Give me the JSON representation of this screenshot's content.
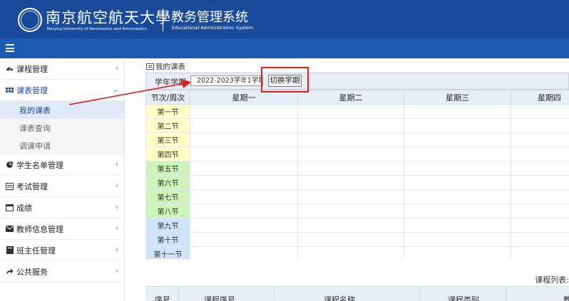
{
  "header": {
    "university_cn": "南京航空航天大學",
    "university_en": "Nanjing University of Aeronautics and Astronautics",
    "system_cn": "教务管理系统",
    "system_en": "Educational Administration System"
  },
  "sidebar": {
    "items": [
      {
        "label": "课程管理",
        "icon": "dashboard-icon"
      },
      {
        "label": "课表管理",
        "icon": "grid-icon",
        "open": true,
        "children": [
          {
            "label": "我的课表",
            "active": true
          },
          {
            "label": "课表查询"
          },
          {
            "label": "调课申请"
          }
        ]
      },
      {
        "label": "学生名单管理",
        "icon": "pie-chart-icon"
      },
      {
        "label": "考试管理",
        "icon": "list-icon"
      },
      {
        "label": "成绩",
        "icon": "calendar-icon"
      },
      {
        "label": "教师信息管理",
        "icon": "envelope-icon"
      },
      {
        "label": "班主任管理",
        "icon": "book-icon"
      },
      {
        "label": "公共服务",
        "icon": "share-icon"
      }
    ]
  },
  "content": {
    "title": "我的课表",
    "term_label": "学年学期:",
    "term_value": "2022-2023学年1学期",
    "switch_button": "切换学期",
    "table_corner": "节次/周次",
    "weekdays": [
      "星期一",
      "星期二",
      "星期三",
      "星期四"
    ],
    "periods": [
      "第一节",
      "第二节",
      "第三节",
      "第四节",
      "第五节",
      "第六节",
      "第七节",
      "第八节",
      "第九节",
      "第十节",
      "第十一节"
    ],
    "course_list_label": "课程列表:",
    "course_columns": [
      "序号",
      "课程序号",
      "课程名称",
      "课程类别",
      "教"
    ]
  },
  "colors": {
    "header_bg": "#1a4a9a",
    "toolbar_bg": "#1c5bb5",
    "annotation_red": "#e21b1b",
    "period_morning": "#ffffc6",
    "period_afternoon": "#cdf5b8",
    "period_evening": "#cde4fb"
  }
}
